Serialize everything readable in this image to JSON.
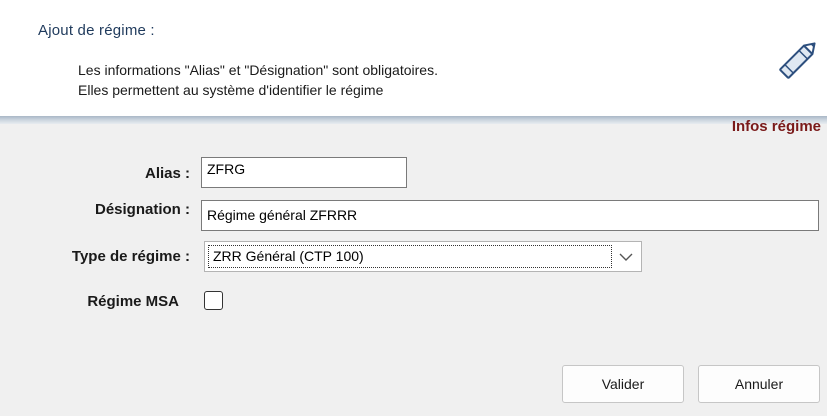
{
  "header": {
    "title": "Ajout de régime :",
    "line1": "Les informations \"Alias\" et \"Désignation\" sont obligatoires.",
    "line2": "Elles permettent au système d'identifier le régime",
    "icon": "pencil-icon"
  },
  "section": {
    "label": "Infos régime"
  },
  "form": {
    "alias_label": "Alias :",
    "alias_value": "ZFRG",
    "designation_label": "Désignation :",
    "designation_value": "Régime général ZFRRR",
    "type_label": "Type de régime :",
    "type_value": "ZRR Général (CTP 100)",
    "msa_label": "Régime MSA",
    "msa_checked": false
  },
  "buttons": {
    "validate": "Valider",
    "cancel": "Annuler"
  },
  "colors": {
    "title": "#1f3a5c",
    "section_label": "#7a1a1a",
    "background": "#f0f0f0"
  }
}
